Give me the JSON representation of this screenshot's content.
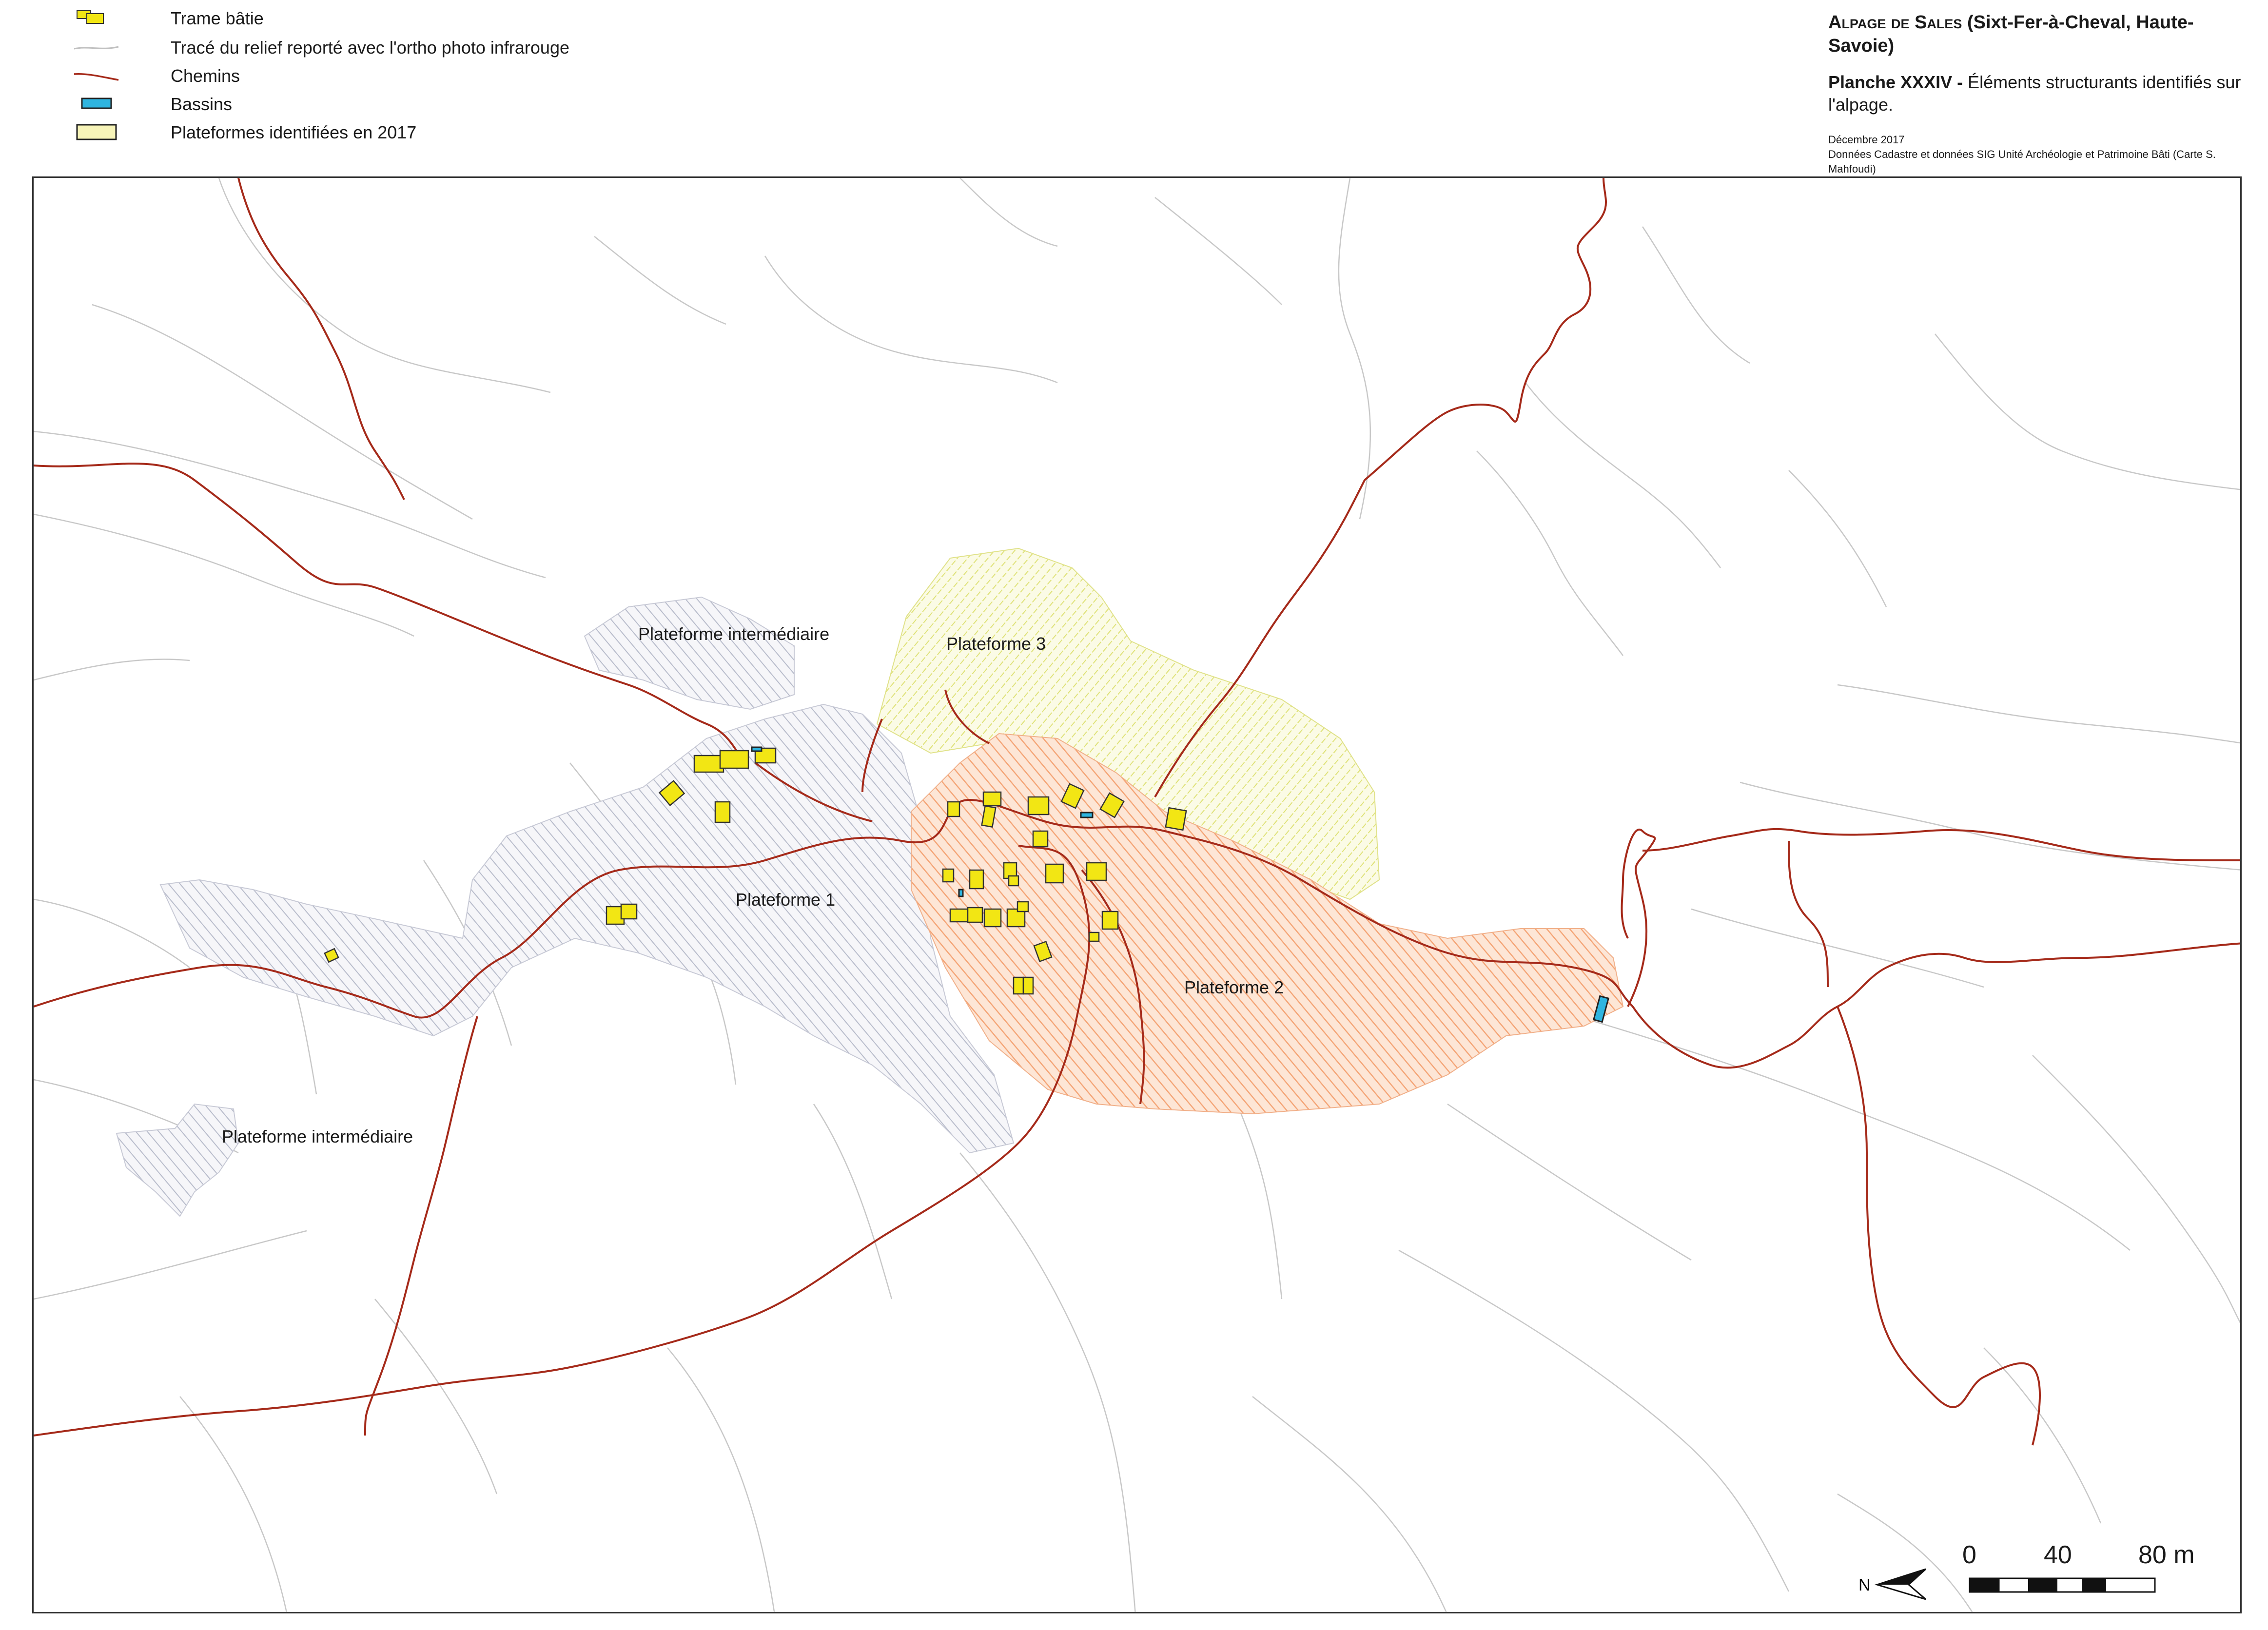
{
  "legend": {
    "items": [
      {
        "key": "bati",
        "label": "Trame bâtie"
      },
      {
        "key": "relief",
        "label": "Tracé du relief reporté avec l'ortho photo infrarouge"
      },
      {
        "key": "chemins",
        "label": "Chemins"
      },
      {
        "key": "bassins",
        "label": "Bassins"
      },
      {
        "key": "plateformes",
        "label": "Plateformes identifiées en 2017"
      }
    ]
  },
  "title": {
    "site_sc": "Alpage de Sales",
    "site_rest": " (Sixt-Fer-à-Cheval, Haute-Savoie)",
    "plate_bold": "Planche XXXIV -",
    "plate_rest": " Éléments structurants identifiés sur l'alpage.",
    "credit_date": "Décembre 2017",
    "credit_source": "Données Cadastre et données SIG Unité Archéologie et Patrimoine Bâti (Carte S. Mahfoudi)"
  },
  "map": {
    "labels": {
      "plateforme_intermediaire_nord": "Plateforme intermédiaire",
      "plateforme_3": "Plateforme 3",
      "plateforme_1": "Plateforme 1",
      "plateforme_2": "Plateforme 2",
      "plateforme_intermediaire_sud": "Plateforme intermédiaire"
    },
    "colors": {
      "chemins": "#a52a1a",
      "relief": "#c8c8c8",
      "bati_fill": "#f2e614",
      "bassin_fill": "#2fb5e0",
      "plateforme_grise": "#b8bccb",
      "plateforme_orange": "#f4a577",
      "plateforme_jaune": "#dfe27a",
      "plateforme_legend_fill": "#f7f4b8"
    }
  },
  "scale": {
    "ticks": [
      "0",
      "40",
      "80 m"
    ],
    "north": "N"
  }
}
